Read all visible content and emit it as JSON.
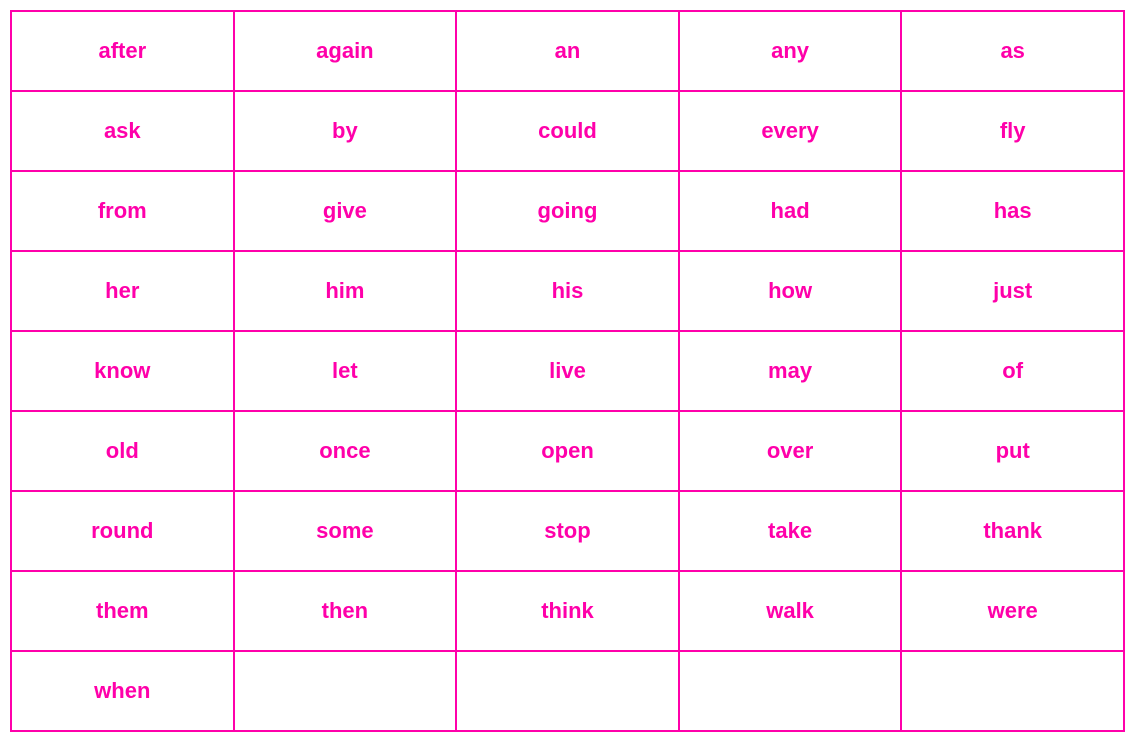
{
  "grid": {
    "rows": [
      [
        "after",
        "again",
        "an",
        "any",
        "as"
      ],
      [
        "ask",
        "by",
        "could",
        "every",
        "fly"
      ],
      [
        "from",
        "give",
        "going",
        "had",
        "has"
      ],
      [
        "her",
        "him",
        "his",
        "how",
        "just"
      ],
      [
        "know",
        "let",
        "live",
        "may",
        "of"
      ],
      [
        "old",
        "once",
        "open",
        "over",
        "put"
      ],
      [
        "round",
        "some",
        "stop",
        "take",
        "thank"
      ],
      [
        "them",
        "then",
        "think",
        "walk",
        "were"
      ],
      [
        "when",
        "",
        "",
        "",
        ""
      ]
    ]
  }
}
